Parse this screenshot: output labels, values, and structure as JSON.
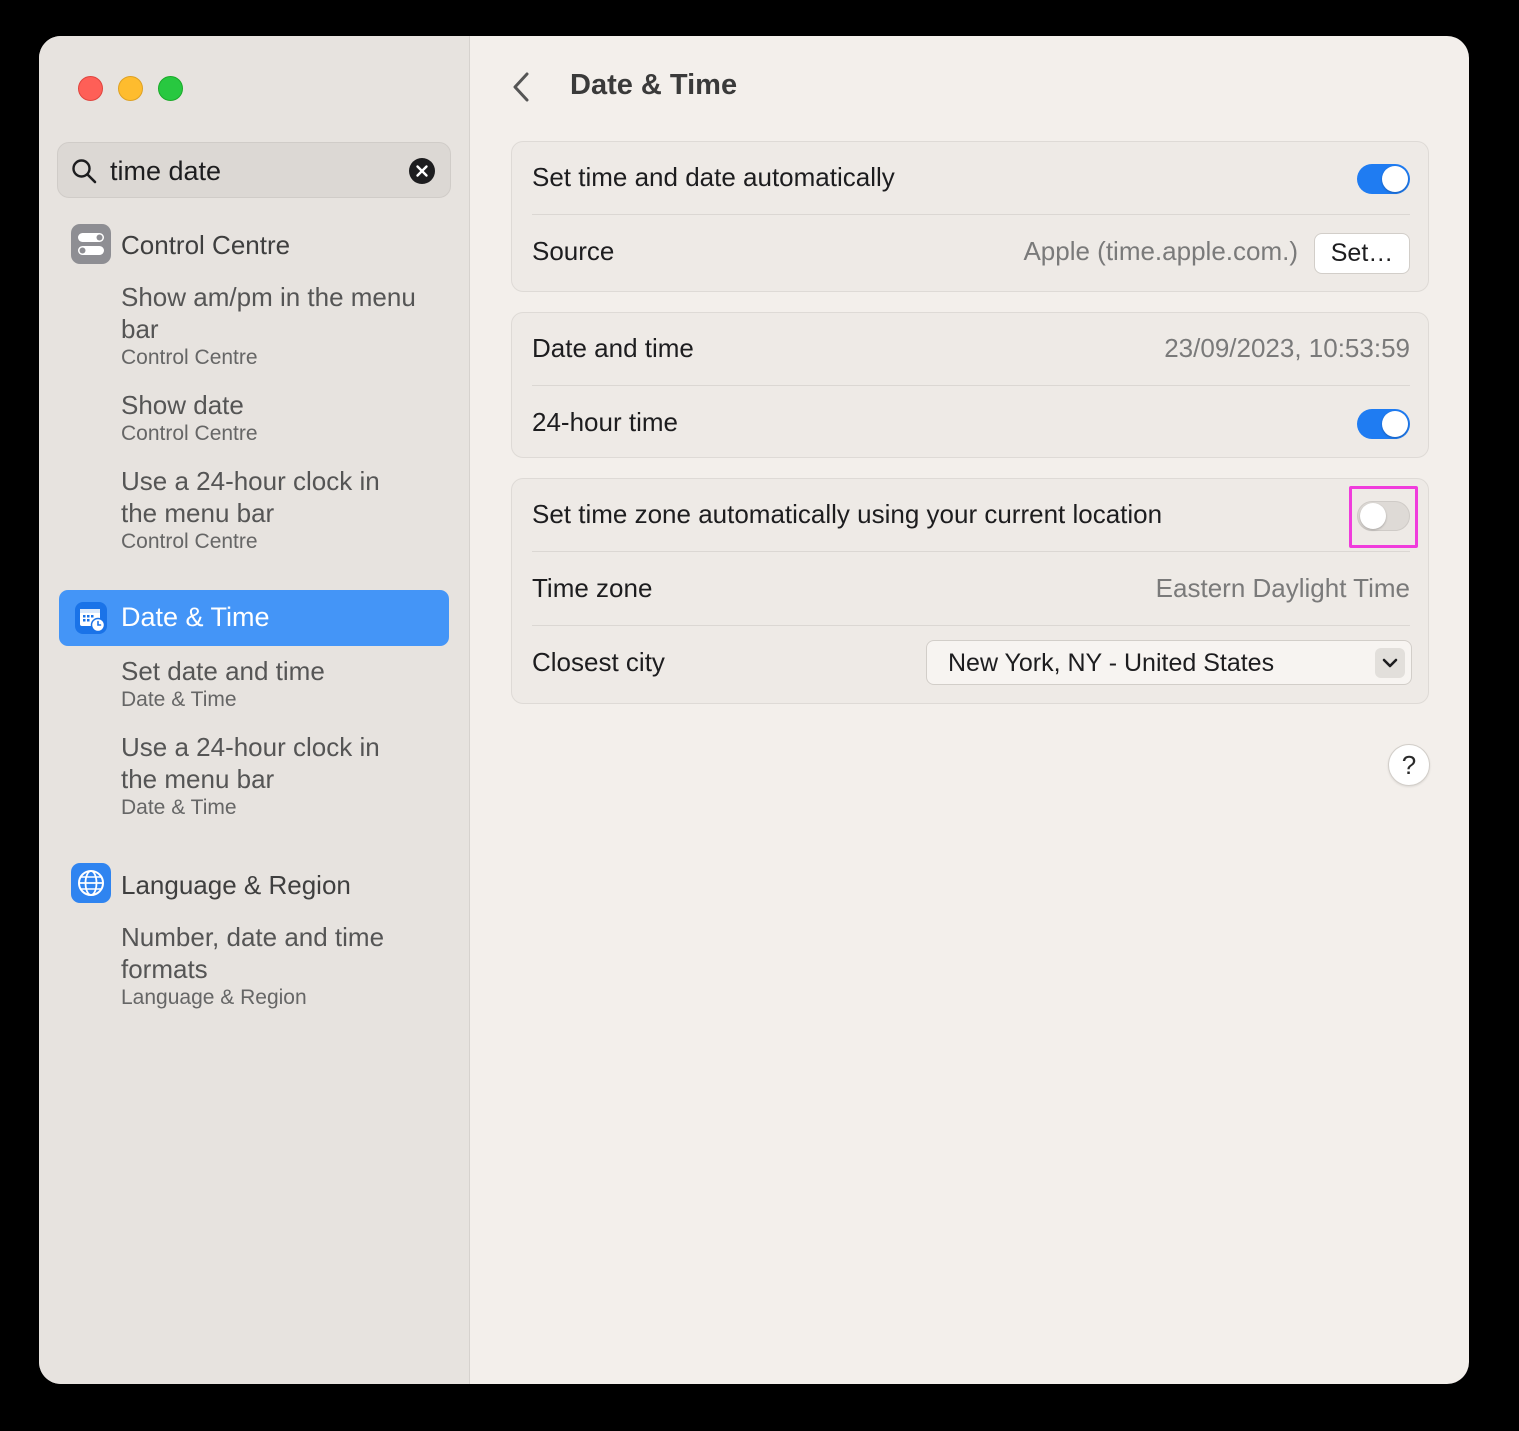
{
  "window": {
    "title": "Date & Time"
  },
  "colors": {
    "accent": "#1f7cf2",
    "selection": "#4495f7",
    "highlight_box": "#f03cdc"
  },
  "sidebar": {
    "search": {
      "value": "time date",
      "icon": "search-icon",
      "clear_icon": "clear-icon"
    },
    "groups": [
      {
        "label": "Control Centre",
        "icon": "control-centre-icon",
        "results": [
          {
            "title": "Show am/pm in the menu bar",
            "subtitle": "Control Centre"
          },
          {
            "title": "Show date",
            "subtitle": "Control Centre"
          },
          {
            "title": "Use a 24-hour clock in the menu bar",
            "subtitle": "Control Centre"
          }
        ]
      },
      {
        "label": "Date & Time",
        "icon": "date-time-icon",
        "selected": true,
        "results": [
          {
            "title": "Set date and time",
            "subtitle": "Date & Time"
          },
          {
            "title": "Use a 24-hour clock in the menu bar",
            "subtitle": "Date & Time"
          }
        ]
      },
      {
        "label": "Language & Region",
        "icon": "globe-icon",
        "results": [
          {
            "title": "Number, date and time formats",
            "subtitle": "Language & Region"
          }
        ]
      }
    ]
  },
  "main": {
    "title": "Date & Time",
    "back_icon": "chevron-left-icon",
    "sections": {
      "auto": {
        "set_auto_label": "Set time and date automatically",
        "set_auto_enabled": true,
        "source_label": "Source",
        "source_value": "Apple (time.apple.com.)",
        "source_button": "Set…"
      },
      "datetime": {
        "date_time_label": "Date and time",
        "date_time_value": "23/09/2023, 10:53:59",
        "hour24_label": "24-hour time",
        "hour24_enabled": true
      },
      "timezone": {
        "auto_tz_label": "Set time zone automatically using your current location",
        "auto_tz_enabled": false,
        "tz_label": "Time zone",
        "tz_value": "Eastern Daylight Time",
        "city_label": "Closest city",
        "city_value": "New York, NY - United States",
        "city_icon": "chevron-down-icon"
      }
    },
    "help_label": "?"
  }
}
